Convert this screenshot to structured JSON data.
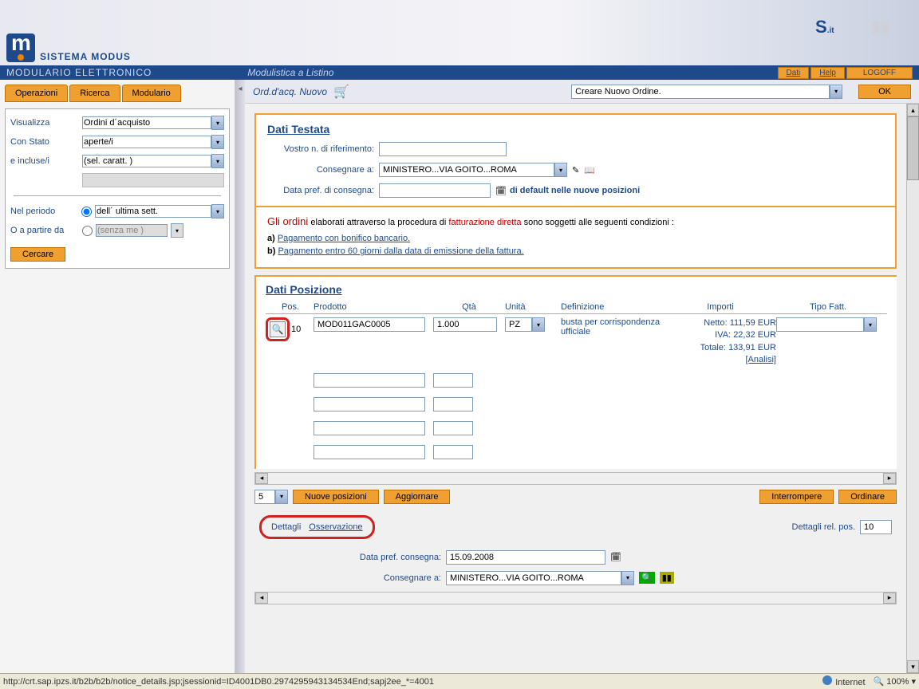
{
  "header": {
    "logo_text": "SISTEMA MODUS",
    "bar_title": "MODULARIO ELETTRONICO",
    "bar_subtitle": "Modulistica a Listino",
    "link_dati": "Dati",
    "link_help": "Help",
    "logoff": "LOGOFF"
  },
  "sidebar": {
    "tabs": {
      "operazioni": "Operazioni",
      "ricerca": "Ricerca",
      "modulario": "Modulario"
    },
    "visualizza_label": "Visualizza",
    "visualizza_value": "Ordini d´acquisto",
    "stato_label": "Con Stato",
    "stato_value": "aperte/i",
    "incluse_label": "e incluse/i",
    "incluse_value": "(sel. caratt. )",
    "periodo_label": "Nel periodo",
    "periodo_value": "dell´ ultima sett.",
    "partire_label": "O a partire da",
    "partire_value": "(senza me )",
    "cercare": "Cercare"
  },
  "action_bar": {
    "title": "Ord.d'acq. Nuovo",
    "dropdown": "Creare Nuovo Ordine.",
    "ok": "OK"
  },
  "testata": {
    "title": "Dati Testata",
    "riferimento_label": "Vostro n. di riferimento:",
    "consegnare_label": "Consegnare a:",
    "consegnare_value": "MINISTERO...VIA GOITO...ROMA",
    "data_pref_label": "Data pref. di consegna:",
    "default_note": " di default nelle nuove posizioni"
  },
  "warning": {
    "intro": "Gli ordini",
    "intro2": " elaborati attraverso la procedura di ",
    "fattura": "fatturazione diretta",
    "intro3": " sono soggetti alle seguenti condizioni :",
    "a_prefix": "a) ",
    "a_link": "Pagamento con bonifico bancario.",
    "b_prefix": "b) ",
    "b_link": "Pagamento entro 60 giorni dalla data di emissione della fattura."
  },
  "posizione": {
    "title": "Dati Posizione",
    "headers": {
      "pos": "Pos.",
      "prodotto": "Prodotto",
      "qta": "Qtà",
      "unita": "Unità",
      "definizione": "Definizione",
      "importi": "Importi",
      "tipo": "Tipo Fatt."
    },
    "row": {
      "pos_num": "10",
      "prodotto": "MOD011GAC0005",
      "qta": "1.000",
      "unita": "PZ",
      "definizione": "busta per corrispondenza ufficiale",
      "netto_label": "Netto:",
      "netto": "111,59 EUR",
      "iva_label": "IVA:",
      "iva": "22,32 EUR",
      "totale_label": "Totale:",
      "totale": "133,91 EUR",
      "analisi": "[Analisi]"
    },
    "pos_count": "5",
    "nuove_posizioni": "Nuove posizioni",
    "aggiornare": "Aggiornare",
    "interrompere": "Interrompere",
    "ordinare": "Ordinare"
  },
  "dettagli": {
    "dettagli_label": "Dettagli",
    "osservazione": "Osservazione",
    "rel_pos_label": "Dettagli rel. pos.",
    "rel_pos_value": "10",
    "data_pref_label": "Data pref. consegna:",
    "data_pref_value": "15.09.2008",
    "consegnare_label": "Consegnare a:",
    "consegnare_value": "MINISTERO...VIA GOITO...ROMA"
  },
  "status": {
    "url": "http://crt.sap.ipzs.it/b2b/b2b/notice_details.jsp;jsessionid=ID4001DB0.2974295943134534End;sapj2ee_*=4001",
    "internet": "Internet",
    "zoom": "100%"
  }
}
